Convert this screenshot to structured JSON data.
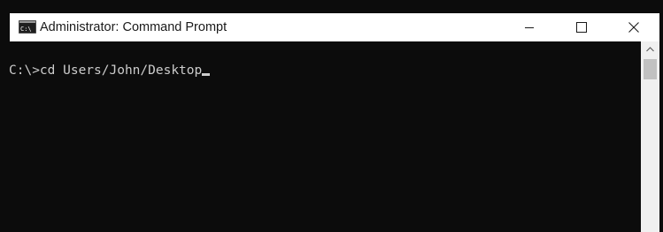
{
  "window": {
    "title": "Administrator: Command Prompt",
    "app_icon": "cmd-icon",
    "title_bar_color": "#ffffff",
    "background_color": "#0c0c0c",
    "text_color": "#cccccc"
  },
  "caption_buttons": {
    "minimize_icon": "minimize-icon",
    "maximize_icon": "maximize-icon",
    "close_icon": "close-icon"
  },
  "console": {
    "line": "C:\\>cd Users/John/Desktop",
    "cursor": "underscore"
  },
  "scrollbar": {
    "up_arrow_icon": "scroll-up-arrow-icon"
  }
}
